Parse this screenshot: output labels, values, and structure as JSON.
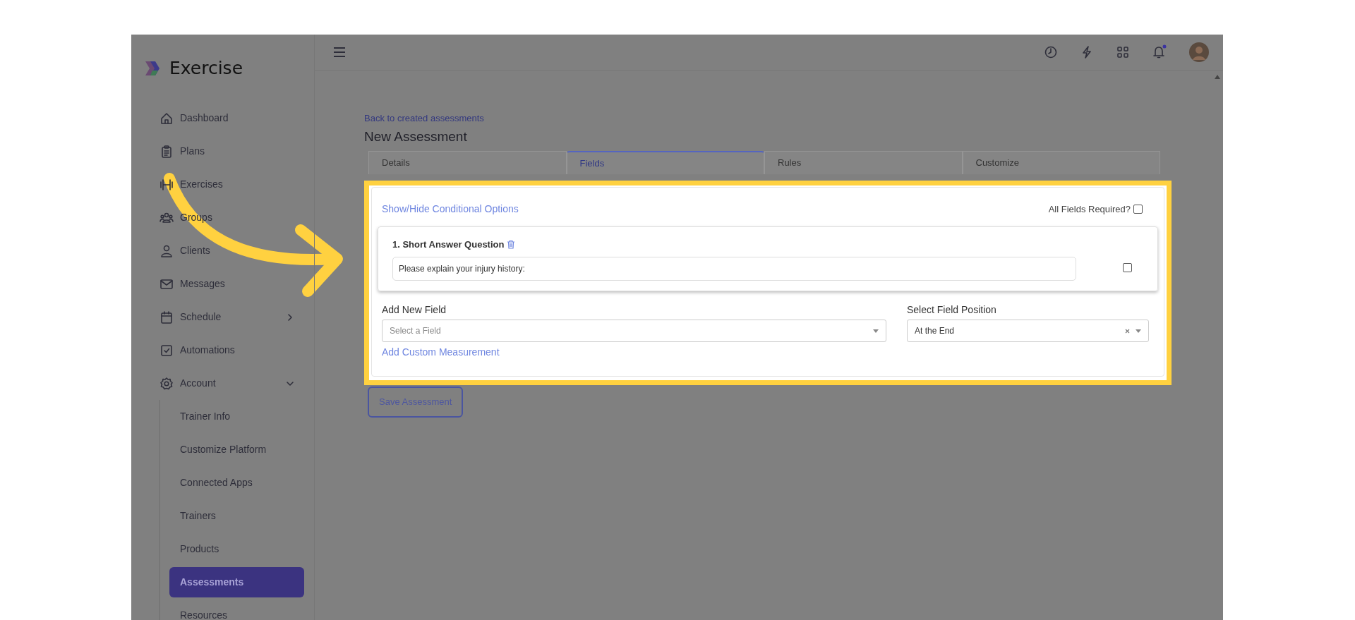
{
  "app_name": "Exercise",
  "sidebar": {
    "items": [
      {
        "label": "Dashboard",
        "selected": false
      },
      {
        "label": "Plans",
        "selected": false
      },
      {
        "label": "Exercises",
        "selected": false
      },
      {
        "label": "Groups",
        "selected": false
      },
      {
        "label": "Clients",
        "selected": false
      },
      {
        "label": "Messages",
        "selected": false
      },
      {
        "label": "Schedule",
        "selected": false,
        "expanded": false
      },
      {
        "label": "Automations",
        "selected": false
      },
      {
        "label": "Account",
        "selected": false,
        "expanded": true,
        "children": [
          {
            "label": "Trainer Info",
            "selected": false
          },
          {
            "label": "Customize Platform",
            "selected": false
          },
          {
            "label": "Connected Apps",
            "selected": false
          },
          {
            "label": "Trainers",
            "selected": false
          },
          {
            "label": "Products",
            "selected": false
          },
          {
            "label": "Assessments",
            "selected": true
          },
          {
            "label": "Resources",
            "selected": false
          }
        ]
      }
    ]
  },
  "page": {
    "back_link": "Back to created assessments",
    "title": "New Assessment",
    "tabs": [
      {
        "label": "Details",
        "selected": false
      },
      {
        "label": "Fields",
        "selected": true
      },
      {
        "label": "Rules",
        "selected": false
      },
      {
        "label": "Customize",
        "selected": false
      }
    ],
    "form": {
      "conditional_link": "Show/Hide Conditional Options",
      "all_required": {
        "label": "All Fields Required?",
        "checked": false
      },
      "questions": [
        {
          "title": "1. Short Answer Question",
          "value": "Please explain your injury history:",
          "checked": false
        }
      ],
      "add_field": {
        "label": "Add New Field",
        "placeholder": "Select a Field"
      },
      "position": {
        "label": "Select Field Position",
        "value": "At the End"
      },
      "custom_link": "Add Custom Measurement"
    },
    "save_button": "Save Assessment"
  }
}
